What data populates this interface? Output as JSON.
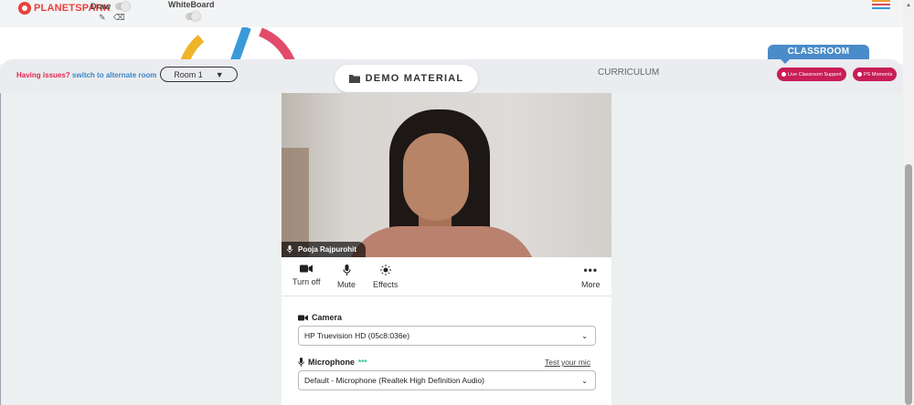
{
  "topbar": {
    "brand": "PLANETSPARK",
    "draw_label": "Draw",
    "whiteboard_label": "WhiteBoard",
    "menu_colors": [
      "#f0a030",
      "#e24c4c",
      "#3a9ad9",
      "#6bbf59"
    ]
  },
  "room_bar": {
    "issues_text": "Having issues?",
    "switch_link": "switch to alternate room",
    "room_value": "Room 1",
    "demo_tab": "DEMO MATERIAL",
    "curriculum_tab": "CURRICULUM",
    "classroom_tab": "CLASSROOM",
    "live_support": "Live Classroom Support",
    "ps_moments": "PS Moments"
  },
  "video": {
    "participant_name": "Pooja Rajpurohit"
  },
  "controls": {
    "turn_off": "Turn off",
    "mute": "Mute",
    "effects": "Effects",
    "more": "More"
  },
  "settings": {
    "camera_label": "Camera",
    "camera_value": "HP Truevision HD (05c8:036e)",
    "microphone_label": "Microphone",
    "mic_activity": "***",
    "test_mic": "Test your mic",
    "microphone_value": "Default - Microphone (Realtek High Definition Audio)"
  },
  "colors": {
    "accent_red": "#c81d56",
    "accent_blue": "#4a8bc9",
    "issues_red": "#e0284f"
  }
}
